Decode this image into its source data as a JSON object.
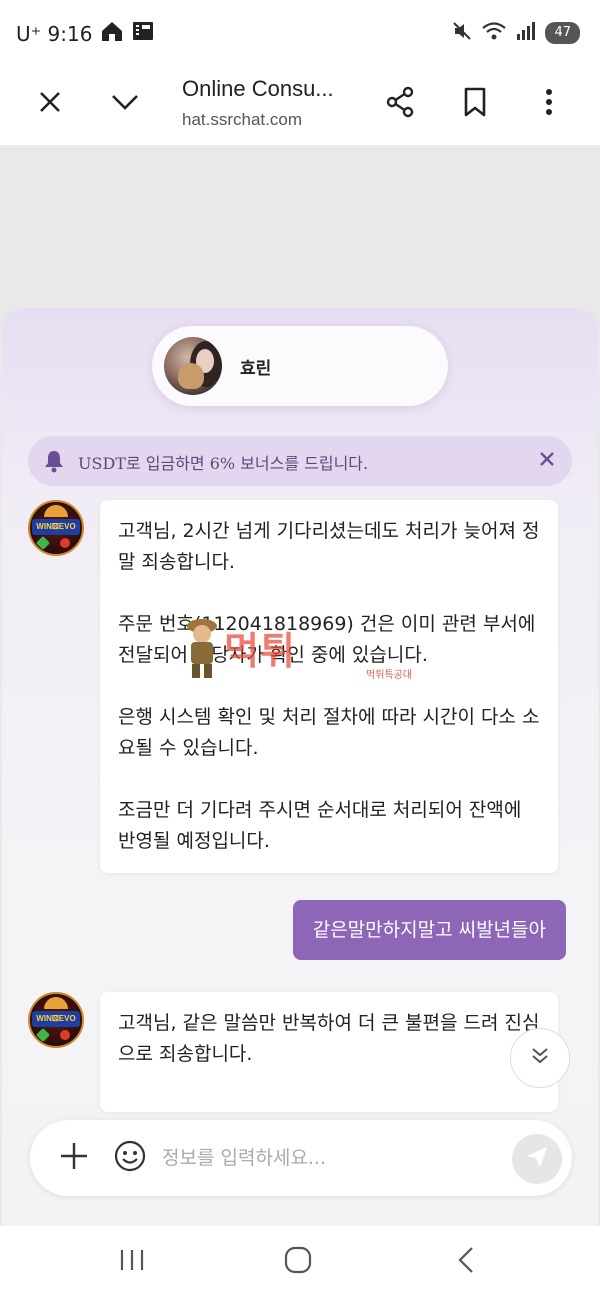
{
  "status_bar": {
    "carrier_time": "U⁺ 9:16",
    "battery": "47"
  },
  "browser": {
    "title": "Online Consu...",
    "url": "hat.ssrchat.com"
  },
  "chat": {
    "agent_name": "효린",
    "notice": "USDT로 입금하면 6% 보너스를 드립니다.",
    "messages": [
      {
        "sender": "bot",
        "paragraphs": [
          "고객님, 2시간 넘게 기다리셨는데도 처리가 늦어져 정말 죄송합니다.",
          "주문 번호(112041818969) 건은 이미 관련 부서에 전달되어 담당자가 확인 중에 있습니다.",
          "은행 시스템 확인 및 처리 절차에 따라 시간이 다소 소요될 수 있습니다.",
          "조금만 더 기다려 주시면 순서대로 처리되어 잔액에 반영될 예정입니다."
        ]
      },
      {
        "sender": "user",
        "text": "같은말만하지말고 씨발년들아"
      },
      {
        "sender": "bot",
        "paragraphs": [
          "고객님, 같은 말씀만 반복하여 더 큰 불편을 드려 진심으로 죄송합니다."
        ]
      }
    ],
    "input_placeholder": "정보를 입력하세요..."
  },
  "watermark": {
    "text": "먹튀",
    "subtext": "먹튀특공대"
  },
  "colors": {
    "accent": "#8e66b8",
    "notice_bg": "#e2d7ef",
    "backdrop": "#e9e9ea"
  },
  "icons": {
    "close": "close-icon",
    "collapse": "chevron-down-icon",
    "share": "share-icon",
    "bookmark": "bookmark-icon",
    "menu": "more-vert-icon",
    "bell": "bell-icon",
    "plus": "plus-icon",
    "emoji": "emoji-icon",
    "send": "send-icon",
    "scroll_down": "double-chevron-down-icon"
  }
}
